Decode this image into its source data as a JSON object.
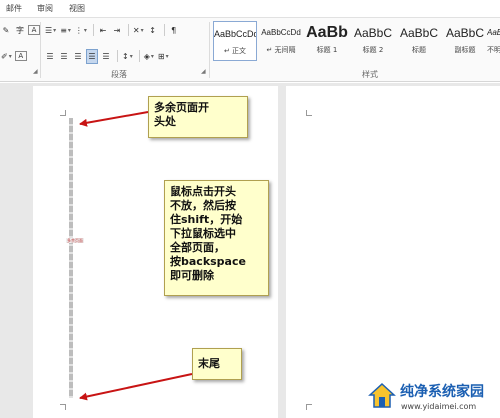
{
  "menubar": {
    "items": [
      "邮件",
      "审阅",
      "视图"
    ]
  },
  "ribbon": {
    "paragraph_label": "段落",
    "styles_label": "样式",
    "styles": [
      {
        "preview": "AaBbCcDd",
        "name": "↵ 正文"
      },
      {
        "preview": "AaBbCcDd",
        "name": "↵ 无间隔"
      },
      {
        "preview": "AaBb",
        "name": "标题 1"
      },
      {
        "preview": "AaBbC",
        "name": "标题 2"
      },
      {
        "preview": "AaBbC",
        "name": "标题"
      },
      {
        "preview": "AaBbC",
        "name": "副标题"
      },
      {
        "preview": "AaB",
        "name": "不明"
      }
    ]
  },
  "document": {
    "tiny_label": "多余页面"
  },
  "callouts": {
    "start": "多余页面开\n头处",
    "instructions": "鼠标点击开头\n不放，然后按\n住shift，开始\n下拉鼠标选中\n全部页面，\n按backspace\n即可删除",
    "end": "末尾"
  },
  "watermark": {
    "title": "纯净系统家园",
    "url": "www.yidaimei.com"
  },
  "colors": {
    "arrow": "#c81414",
    "callout_bg": "#ffffcc",
    "brand": "#1b5fb2"
  }
}
